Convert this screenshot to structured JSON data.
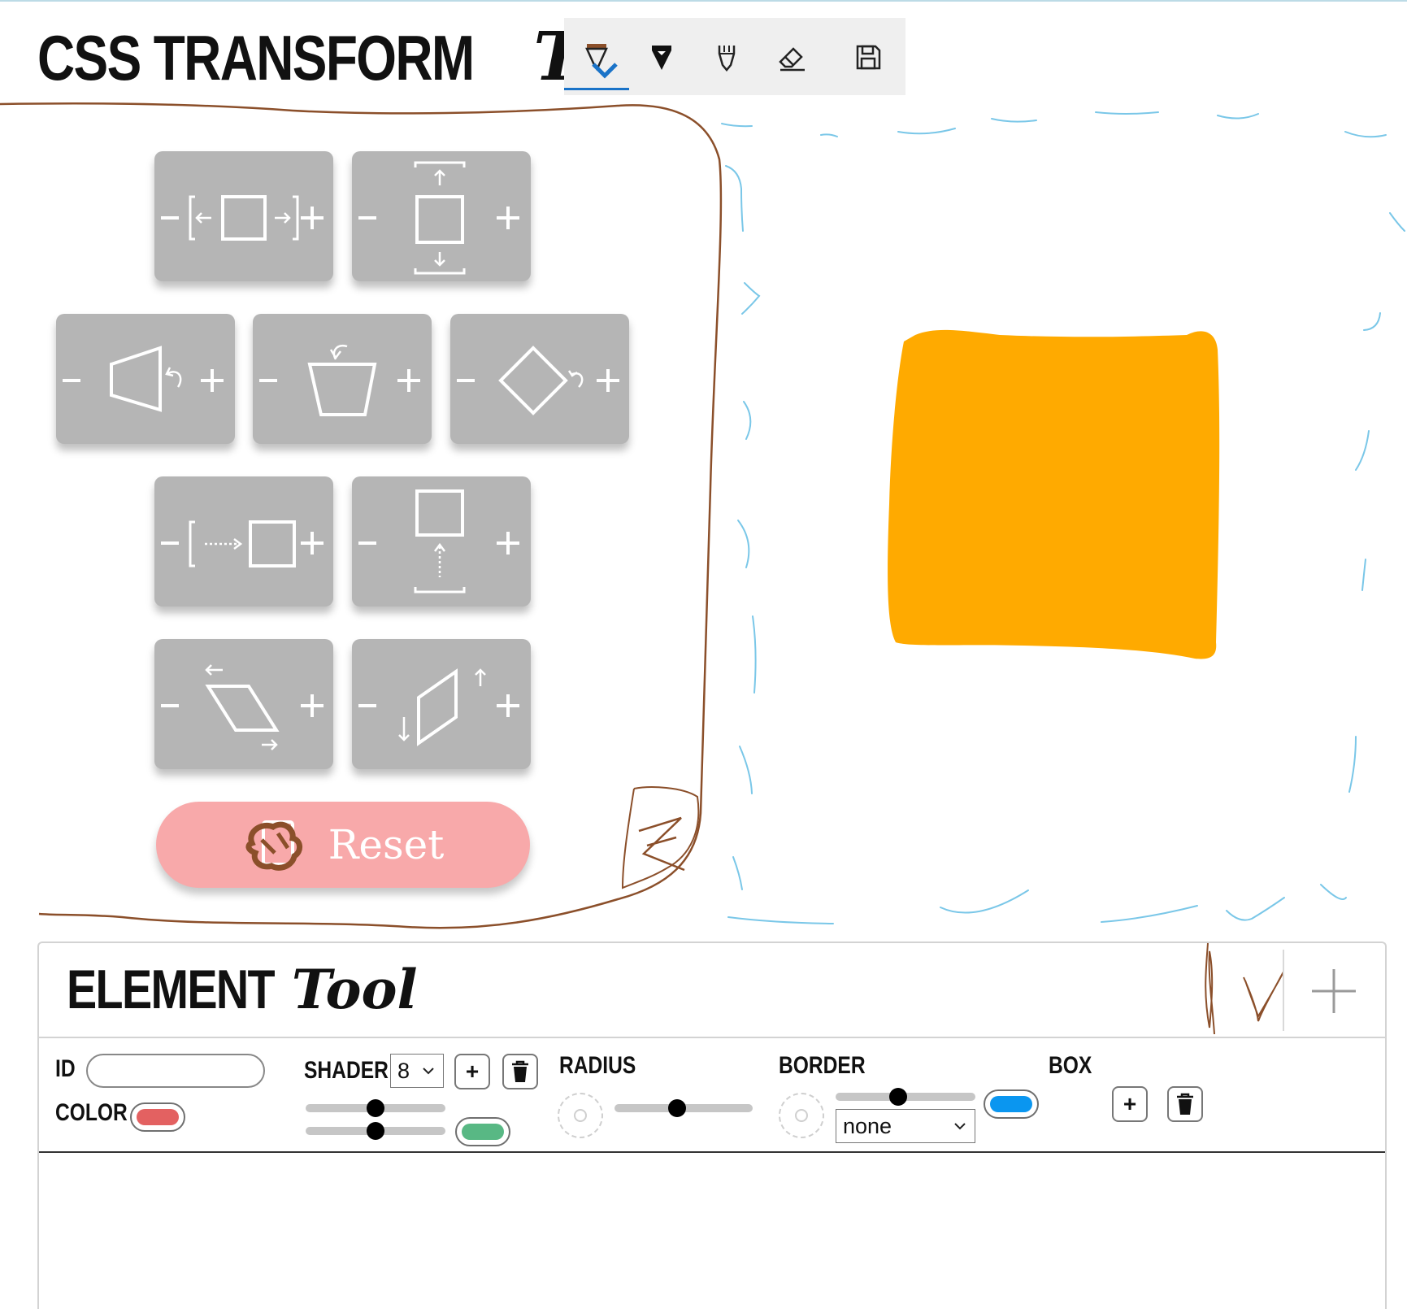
{
  "app": {
    "title_main": "CSS TRANSFORM",
    "title_script": "Tool"
  },
  "ink_toolbar": {
    "tools": [
      "ballpoint-pen",
      "pencil",
      "highlighter",
      "eraser",
      "save"
    ],
    "selected_tool": "ballpoint-pen",
    "accent_color": "#1a73c8",
    "pen_color": "#8b4f2a"
  },
  "transform_buttons": [
    {
      "name": "scale-x",
      "minus": "-",
      "plus": "+"
    },
    {
      "name": "scale-y",
      "minus": "-",
      "plus": "+"
    },
    {
      "name": "rotate-y",
      "minus": "-",
      "plus": "+"
    },
    {
      "name": "rotate-x",
      "minus": "-",
      "plus": "+"
    },
    {
      "name": "rotate-z",
      "minus": "-",
      "plus": "+"
    },
    {
      "name": "translate-x",
      "minus": "-",
      "plus": "+"
    },
    {
      "name": "translate-y",
      "minus": "-",
      "plus": "+"
    },
    {
      "name": "skew-x",
      "minus": "-",
      "plus": "+"
    },
    {
      "name": "skew-y",
      "minus": "-",
      "plus": "+"
    }
  ],
  "reset": {
    "label": "Reset",
    "color": "#f8a9aa"
  },
  "preview": {
    "element_color": "#ffaa00"
  },
  "element_tool": {
    "title_main": "ELEMENT",
    "title_script": "Tool",
    "add_label": "+",
    "id": {
      "label": "ID",
      "value": ""
    },
    "color": {
      "label": "COLOR",
      "swatch": "#e36161"
    },
    "shader": {
      "label": "SHADER",
      "selected": "8",
      "add_label": "+",
      "swatch": "#58b884",
      "slider1": 0.5,
      "slider2": 0.5
    },
    "radius": {
      "label": "RADIUS",
      "slider": 0.5
    },
    "border": {
      "label": "BORDER",
      "slider": 0.5,
      "style_selected": "none",
      "swatch": "#0a96f0"
    },
    "box": {
      "label": "BOX",
      "add_label": "+"
    }
  }
}
